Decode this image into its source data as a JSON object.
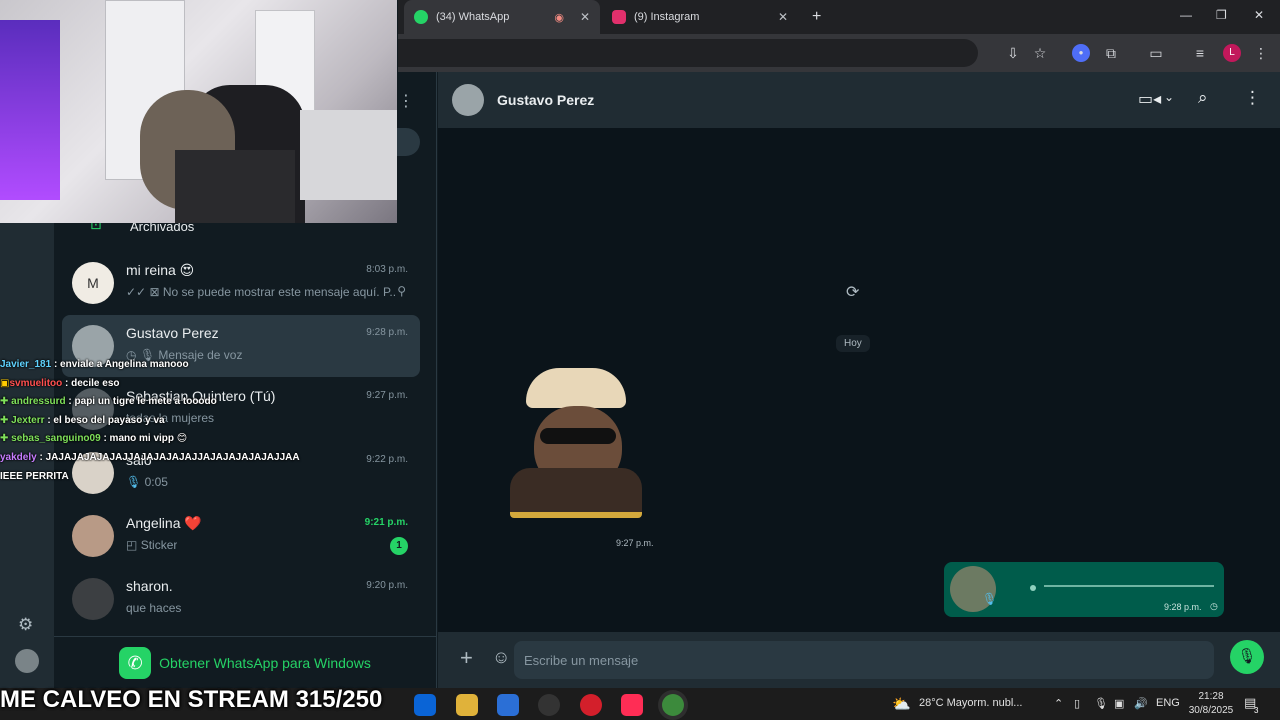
{
  "browser": {
    "tabs": [
      {
        "label": "(34) WhatsApp",
        "color": "#25d366",
        "active": true
      },
      {
        "label": "(9) Instagram",
        "color": "#e1306c",
        "active": false
      }
    ],
    "new_tab": "+",
    "profile_initial": "L"
  },
  "sidebar": {
    "archived_label": "Archivados",
    "chats": [
      {
        "name": "mi reina 😍",
        "time": "8:03 p.m.",
        "preview": "✓✓ ⊠ No se puede mostrar este mensaje aquí. P...",
        "pinned": true
      },
      {
        "name": "Gustavo Perez",
        "time": "9:28 p.m.",
        "preview": "Mensaje de voz",
        "selected": true
      },
      {
        "name": "Sebastian Quintero (Tú)",
        "time": "9:27 p.m.",
        "preview": "todas la mujeres"
      },
      {
        "name": "salo",
        "time": "9:22 p.m.",
        "preview": "0:05"
      },
      {
        "name": "Angelina ❤️",
        "time": "9:21 p.m.",
        "preview": "Sticker",
        "unread": "1"
      },
      {
        "name": "sharon.",
        "time": "9:20 p.m.",
        "preview": "que haces"
      }
    ],
    "get_app_label": "Obtener WhatsApp para Windows"
  },
  "stream_chat": [
    {
      "user": "Javier_181",
      "msg": ": enviale a Angelina manooo",
      "color": "#5fd3ff"
    },
    {
      "user": "svmuelitoo",
      "msg": ": decile eso",
      "color": "#ff4f4f"
    },
    {
      "user": "andressurd",
      "msg": ": papi un tigre le mete a tooodo",
      "color": "#7fe05a"
    },
    {
      "user": "Jexterr",
      "msg": ": el beso del payaso y va",
      "color": "#7fe05a"
    },
    {
      "user": "sebas_sanguino09",
      "msg": ": mano mi vipp 😊",
      "color": "#7fe05a"
    },
    {
      "user": "yakdely",
      "msg": ": JAJAJAJAJAJAJJAJAJAJAJAJJAJAJAJAJAJAJJAA",
      "color": "#c77dff"
    },
    {
      "user": "",
      "msg": "IEEE PERRITA",
      "color": "#ffffff"
    }
  ],
  "chat": {
    "contact_name": "Gustavo Perez",
    "date_divider": "Hoy",
    "sticker_time": "9:27 p.m.",
    "voice_time": "9:28 p.m.",
    "input_placeholder": "Escribe un mensaje"
  },
  "stream_banner": "ME CALVEO EN STREAM 315/250",
  "taskbar": {
    "weather": "28°C  Mayorm. nubl...",
    "lang": "ENG",
    "time": "21:28",
    "date": "30/8/2025",
    "notifications": "3"
  }
}
